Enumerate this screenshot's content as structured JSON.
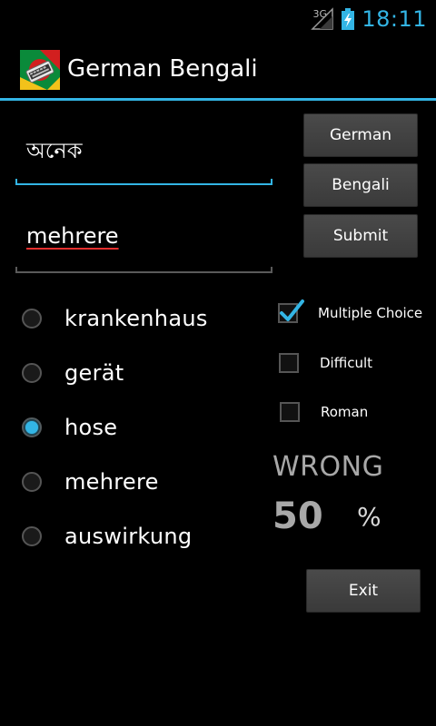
{
  "status_bar": {
    "network": "3G",
    "time": "18:11"
  },
  "app": {
    "title": "German Bengali",
    "accent_color": "#33b5e5"
  },
  "inputs": {
    "question_value": "অনেক",
    "answer_value": "mehrere"
  },
  "buttons": {
    "german": "German",
    "bengali": "Bengali",
    "submit": "Submit",
    "exit": "Exit"
  },
  "choices": [
    {
      "label": "krankenhaus",
      "selected": false
    },
    {
      "label": "gerät",
      "selected": false
    },
    {
      "label": "hose",
      "selected": true
    },
    {
      "label": "mehrere",
      "selected": false
    },
    {
      "label": "auswirkung",
      "selected": false
    }
  ],
  "options": {
    "multiple_choice": {
      "label": "Multiple Choice",
      "checked": true
    },
    "difficult": {
      "label": "Difficult",
      "checked": false
    },
    "roman": {
      "label": "Roman",
      "checked": false
    }
  },
  "result": {
    "status": "WRONG",
    "score": "50",
    "unit": "%"
  }
}
